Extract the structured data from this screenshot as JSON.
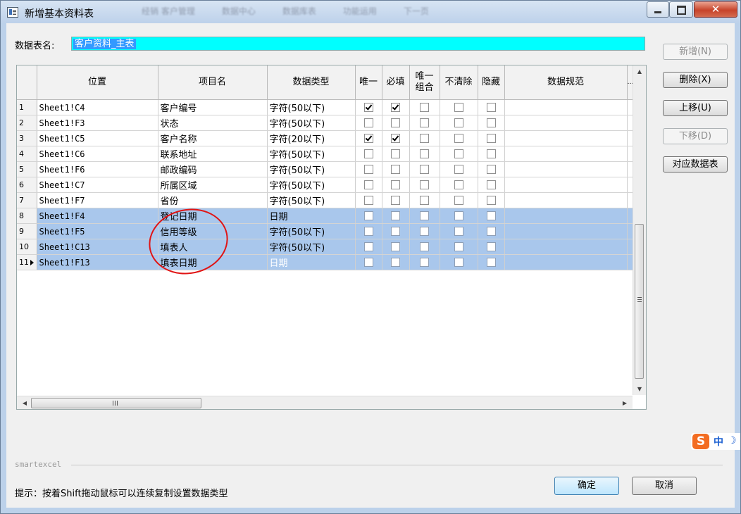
{
  "window": {
    "title": "新增基本资料表",
    "background_tabs": [
      "经销 客户管理",
      "数据中心",
      "数据库表",
      "功能运用",
      "下一页"
    ],
    "controls": [
      "minimize",
      "maximize",
      "close"
    ]
  },
  "form": {
    "table_name_label": "数据表名:",
    "table_name_value": "客户资料_主表"
  },
  "grid": {
    "columns": [
      "位置",
      "项目名",
      "数据类型",
      "唯一",
      "必填",
      "唯一组合",
      "不清除",
      "隐藏",
      "数据规范",
      "…"
    ],
    "column_unique_combo_line1": "唯一",
    "column_unique_combo_line2": "组合",
    "rows": [
      {
        "num": "1",
        "pos": "Sheet1!C4",
        "name": "客户编号",
        "type": "字符(50以下)",
        "unique": true,
        "required": true,
        "combo": false,
        "noclear": false,
        "hidden": false,
        "selected": false
      },
      {
        "num": "2",
        "pos": "Sheet1!F3",
        "name": "状态",
        "type": "字符(50以下)",
        "unique": false,
        "required": false,
        "combo": false,
        "noclear": false,
        "hidden": false,
        "selected": false
      },
      {
        "num": "3",
        "pos": "Sheet1!C5",
        "name": "客户名称",
        "type": "字符(20以下)",
        "unique": true,
        "required": true,
        "combo": false,
        "noclear": false,
        "hidden": false,
        "selected": false
      },
      {
        "num": "4",
        "pos": "Sheet1!C6",
        "name": "联系地址",
        "type": "字符(50以下)",
        "unique": false,
        "required": false,
        "combo": false,
        "noclear": false,
        "hidden": false,
        "selected": false
      },
      {
        "num": "5",
        "pos": "Sheet1!F6",
        "name": "邮政编码",
        "type": "字符(50以下)",
        "unique": false,
        "required": false,
        "combo": false,
        "noclear": false,
        "hidden": false,
        "selected": false
      },
      {
        "num": "6",
        "pos": "Sheet1!C7",
        "name": "所属区域",
        "type": "字符(50以下)",
        "unique": false,
        "required": false,
        "combo": false,
        "noclear": false,
        "hidden": false,
        "selected": false
      },
      {
        "num": "7",
        "pos": "Sheet1!F7",
        "name": "省份",
        "type": "字符(50以下)",
        "unique": false,
        "required": false,
        "combo": false,
        "noclear": false,
        "hidden": false,
        "selected": false
      },
      {
        "num": "8",
        "pos": "Sheet1!F4",
        "name": "登记日期",
        "type": "日期",
        "unique": false,
        "required": false,
        "combo": false,
        "noclear": false,
        "hidden": false,
        "selected": true
      },
      {
        "num": "9",
        "pos": "Sheet1!F5",
        "name": "信用等级",
        "type": "字符(50以下)",
        "unique": false,
        "required": false,
        "combo": false,
        "noclear": false,
        "hidden": false,
        "selected": true
      },
      {
        "num": "10",
        "pos": "Sheet1!C13",
        "name": "填表人",
        "type": "字符(50以下)",
        "unique": false,
        "required": false,
        "combo": false,
        "noclear": false,
        "hidden": false,
        "selected": true
      },
      {
        "num": "11",
        "pos": "Sheet1!F13",
        "name": "填表日期",
        "type": "日期",
        "unique": false,
        "required": false,
        "combo": false,
        "noclear": false,
        "hidden": false,
        "selected": true,
        "current": true,
        "type_faded": true
      }
    ]
  },
  "side_buttons": {
    "add": "新增(N)",
    "delete": "删除(X)",
    "move_up": "上移(U)",
    "move_down": "下移(D)",
    "map_table": "对应数据表"
  },
  "footer": {
    "group_label": "smartexcel",
    "hint": "提示：按着Shift拖动鼠标可以连续复制设置数据类型",
    "ok": "确定",
    "cancel": "取消"
  },
  "ime": {
    "logo": "S",
    "mode": "中",
    "moon": "☽"
  },
  "colors": {
    "table_name_bg": "#00ffff",
    "selection": "#3399ff",
    "row_highlight": "#a9c7ec",
    "annotation_circle": "#e01414"
  }
}
